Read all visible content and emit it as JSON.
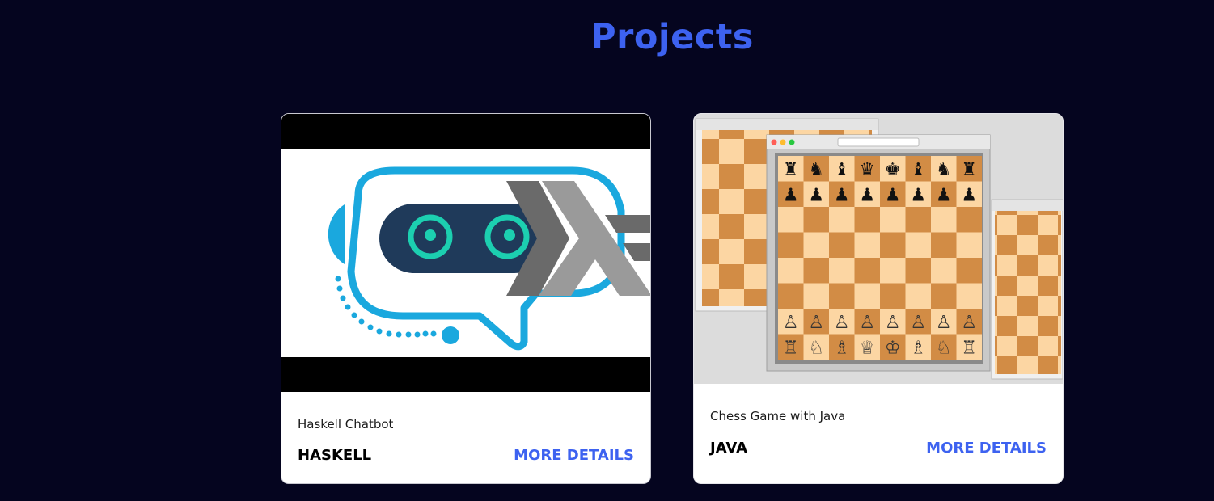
{
  "section": {
    "title": "Projects"
  },
  "projects": [
    {
      "image_alt": "Haskell chatbot robot logo",
      "title": "Haskell Chatbot",
      "tag": "HASKELL",
      "link_label": "MORE DETAILS"
    },
    {
      "image_alt": "Java chess game windows",
      "title": "Chess Game with Java",
      "tag": "JAVA",
      "link_label": "MORE DETAILS"
    }
  ],
  "colors": {
    "background": "#05051f",
    "accent": "#3d62f0",
    "card": "#ffffff",
    "robot_blue": "#1aa8de",
    "robot_visor": "#1f3a5a",
    "robot_eyes": "#1ccfb0",
    "board_light": "#fcd6a3",
    "board_dark": "#d28c45"
  }
}
